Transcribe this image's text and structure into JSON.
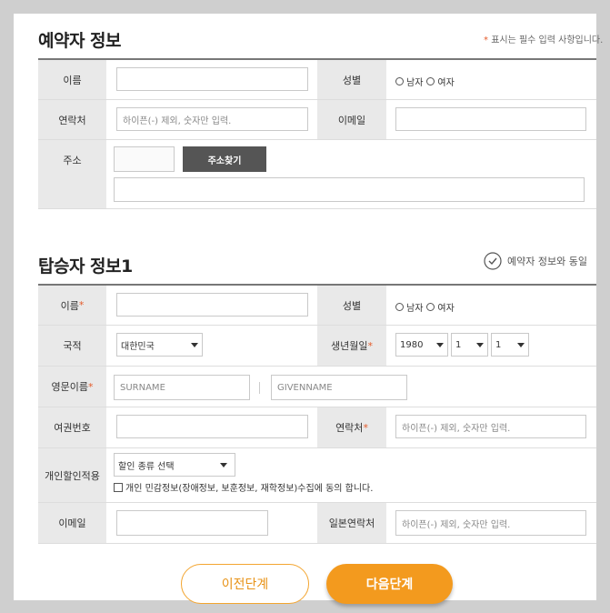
{
  "booker": {
    "title": "예약자 정보",
    "required_note_star": "*",
    "required_note": "표시는 필수 입력 사항입니다.",
    "name_label": "이름",
    "gender_label": "성별",
    "male": "남자",
    "female": "여자",
    "contact_label": "연락처",
    "contact_placeholder": "하이픈(-) 제외, 숫자만 입력.",
    "email_label": "이메일",
    "address_label": "주소",
    "address_search_button": "주소찾기"
  },
  "passenger": {
    "title": "탑승자 정보1",
    "same_as_booker": "예약자 정보와 동일",
    "name_label": "이름",
    "gender_label": "성별",
    "male": "남자",
    "female": "여자",
    "nationality_label": "국적",
    "nationality_value": "대한민국",
    "birth_label": "생년월일",
    "birth_year": "1980",
    "birth_month": "1",
    "birth_day": "1",
    "english_name_label": "영문이름",
    "surname_placeholder": "SURNAME",
    "givenname_placeholder": "GIVENNAME",
    "passport_label": "여권번호",
    "contact_label": "연락처",
    "contact_placeholder": "하이픈(-) 제외, 숫자만 입력.",
    "discount_label": "개인할인적용",
    "discount_select": "할인 종류 선택",
    "consent_text": "개인 민감정보(장애정보, 보훈정보, 재학정보)수집에 동의 합니다.",
    "email_label": "이메일",
    "japan_contact_label": "일본연락처",
    "japan_contact_placeholder": "하이픈(-) 제외, 숫자만 입력."
  },
  "buttons": {
    "prev": "이전단계",
    "next": "다음단계"
  },
  "colors": {
    "accent": "#f39a1e",
    "required": "#e45b2b",
    "label_bg": "#e9e9e9"
  }
}
